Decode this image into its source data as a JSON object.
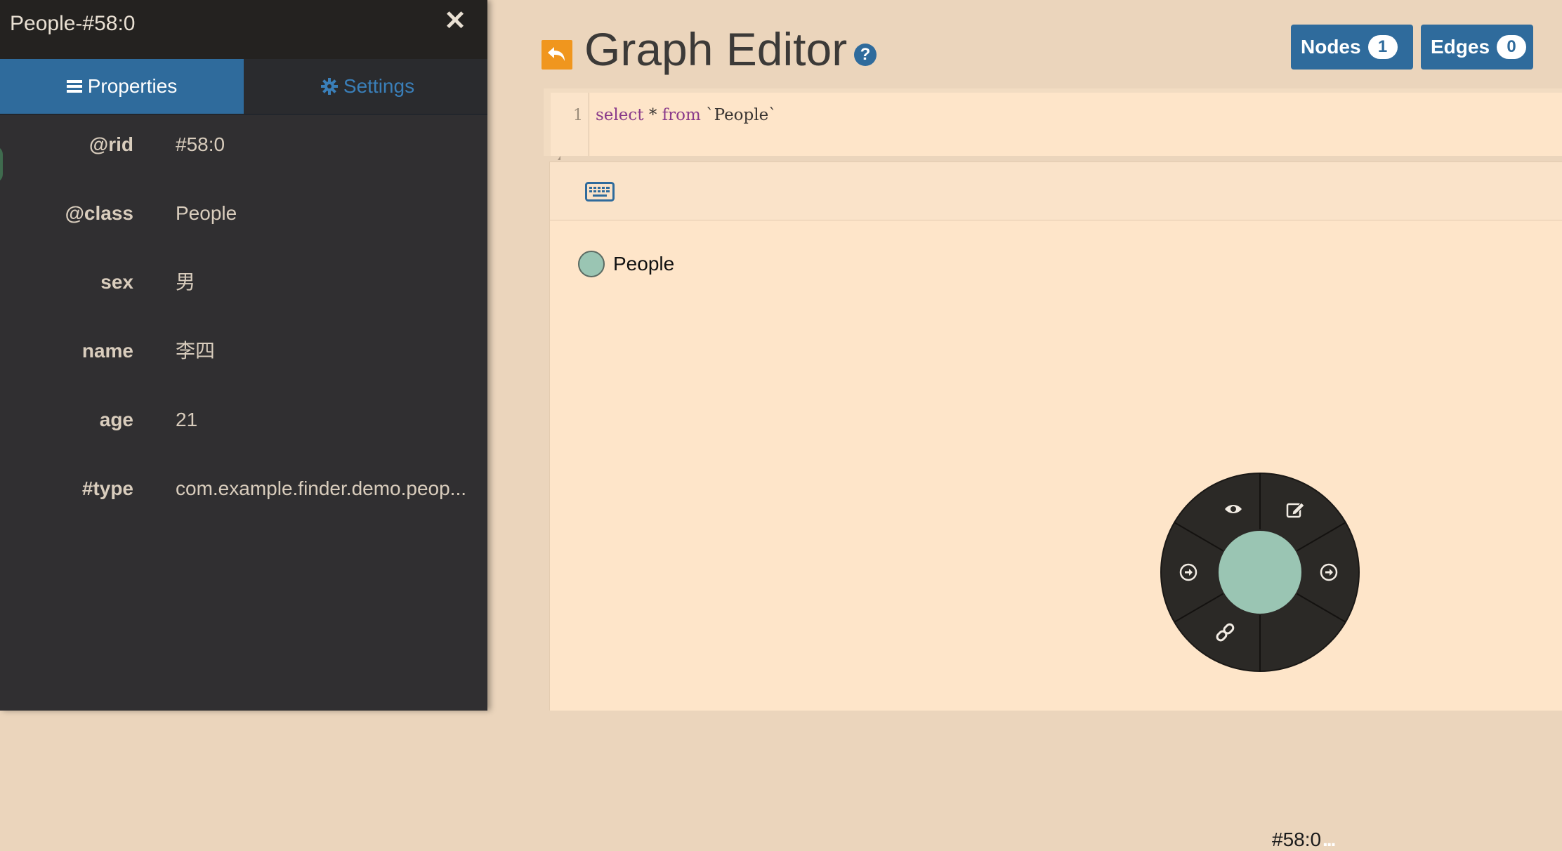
{
  "panel": {
    "title": "People-#58:0",
    "close_glyph": "✕",
    "tabs": [
      {
        "label": "Properties",
        "icon": "list-icon",
        "active": true
      },
      {
        "label": "Settings",
        "icon": "gear-icon",
        "active": false
      }
    ],
    "properties": [
      {
        "key": "@rid",
        "value": "#58:0"
      },
      {
        "key": "@class",
        "value": "People"
      },
      {
        "key": "sex",
        "value": "男"
      },
      {
        "key": "name",
        "value": "李四"
      },
      {
        "key": "age",
        "value": "21"
      },
      {
        "key": "#type",
        "value": "com.example.finder.demo.peop..."
      }
    ]
  },
  "header": {
    "title": "Graph Editor",
    "help_glyph": "?",
    "nodes_label": "Nodes",
    "nodes_count": "1",
    "edges_label": "Edges",
    "edges_count": "0"
  },
  "editor": {
    "line_number": "1",
    "query_tokens": [
      {
        "text": "select",
        "kind": "keyword"
      },
      {
        "text": " * ",
        "kind": "plain"
      },
      {
        "text": "from",
        "kind": "keyword"
      },
      {
        "text": " `People`",
        "kind": "plain"
      }
    ]
  },
  "legend": {
    "label": "People",
    "color": "#9ac5b3"
  },
  "node": {
    "label": "#58:0",
    "more_glyph": "...",
    "color": "#9ac5b3",
    "menu_icons": [
      "eye-icon",
      "edit-icon",
      "arrow-right-circle-icon",
      "arrow-right-circle-icon",
      "link-icon",
      "more-icon"
    ]
  },
  "colors": {
    "accent": "#2f6b9c",
    "back_button": "#f0961e",
    "panel_bg": "#302f31",
    "canvas_bg": "#fee5c9"
  }
}
